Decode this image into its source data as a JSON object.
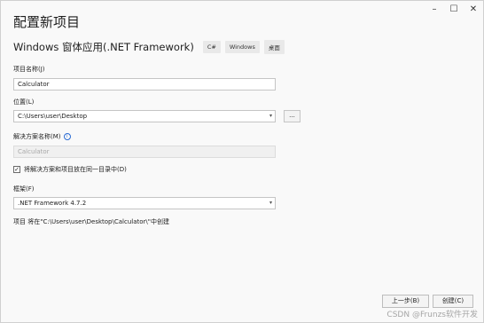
{
  "window": {
    "title": "配置新项目",
    "controls": {
      "minimize": "–",
      "maximize": "☐",
      "close": "✕"
    }
  },
  "template": {
    "name": "Windows 窗体应用(.NET Framework)",
    "tags": [
      "C#",
      "Windows",
      "桌面"
    ]
  },
  "project_name": {
    "label": "项目名称(J)",
    "value": "Calculator"
  },
  "location": {
    "label": "位置(L)",
    "value": "C:\\Users\\user\\Desktop",
    "browse_label": "..."
  },
  "solution_name": {
    "label": "解决方案名称(M)",
    "value": "Calculator",
    "icon": "info-icon"
  },
  "same_dir": {
    "label": "将解决方案和项目放在同一目录中(D)",
    "checked": true
  },
  "framework": {
    "label": "框架(F)",
    "value": ".NET Framework 4.7.2"
  },
  "note": "项目 将在\"C:\\Users\\user\\Desktop\\Calculator\\\"中创建",
  "buttons": {
    "back": "上一步(B)",
    "create": "创建(C)"
  },
  "watermark": "CSDN @Frunzs软件开发"
}
